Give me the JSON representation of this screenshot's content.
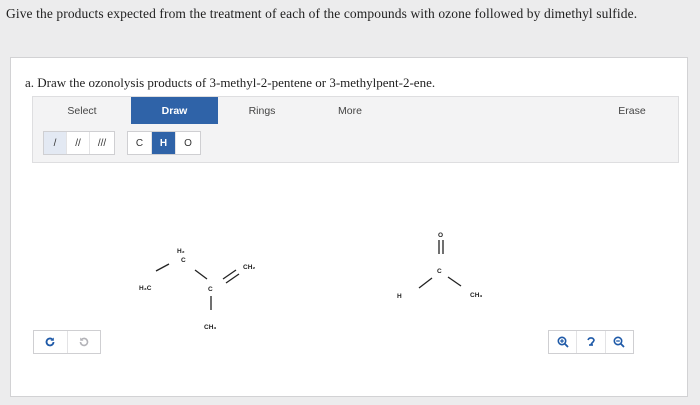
{
  "question": "Give the products expected from the treatment of each of the compounds with ozone followed by dimethyl sulfide.",
  "part_a": "a. Draw the ozonolysis products of 3-methyl-2-pentene or 3-methylpent-2-ene.",
  "toolbar": {
    "select": "Select",
    "draw": "Draw",
    "rings": "Rings",
    "more": "More",
    "erase": "Erase"
  },
  "bond_tools": [
    "/",
    "//",
    "///"
  ],
  "atom_tools": [
    "C",
    "H",
    "O"
  ],
  "molecule1": {
    "labels": [
      "H₃C",
      "H₂",
      "C",
      "CH₂",
      "C",
      "CH₃"
    ]
  },
  "molecule2": {
    "labels": [
      "O",
      "C",
      "H",
      "CH₃"
    ]
  },
  "icons": [
    "undo-icon",
    "redo-icon",
    "zoom-in-icon",
    "reset-zoom-icon",
    "zoom-out-icon"
  ],
  "colors": {
    "accent": "#2f63a8",
    "icon_blue": "#1f5aa8"
  }
}
